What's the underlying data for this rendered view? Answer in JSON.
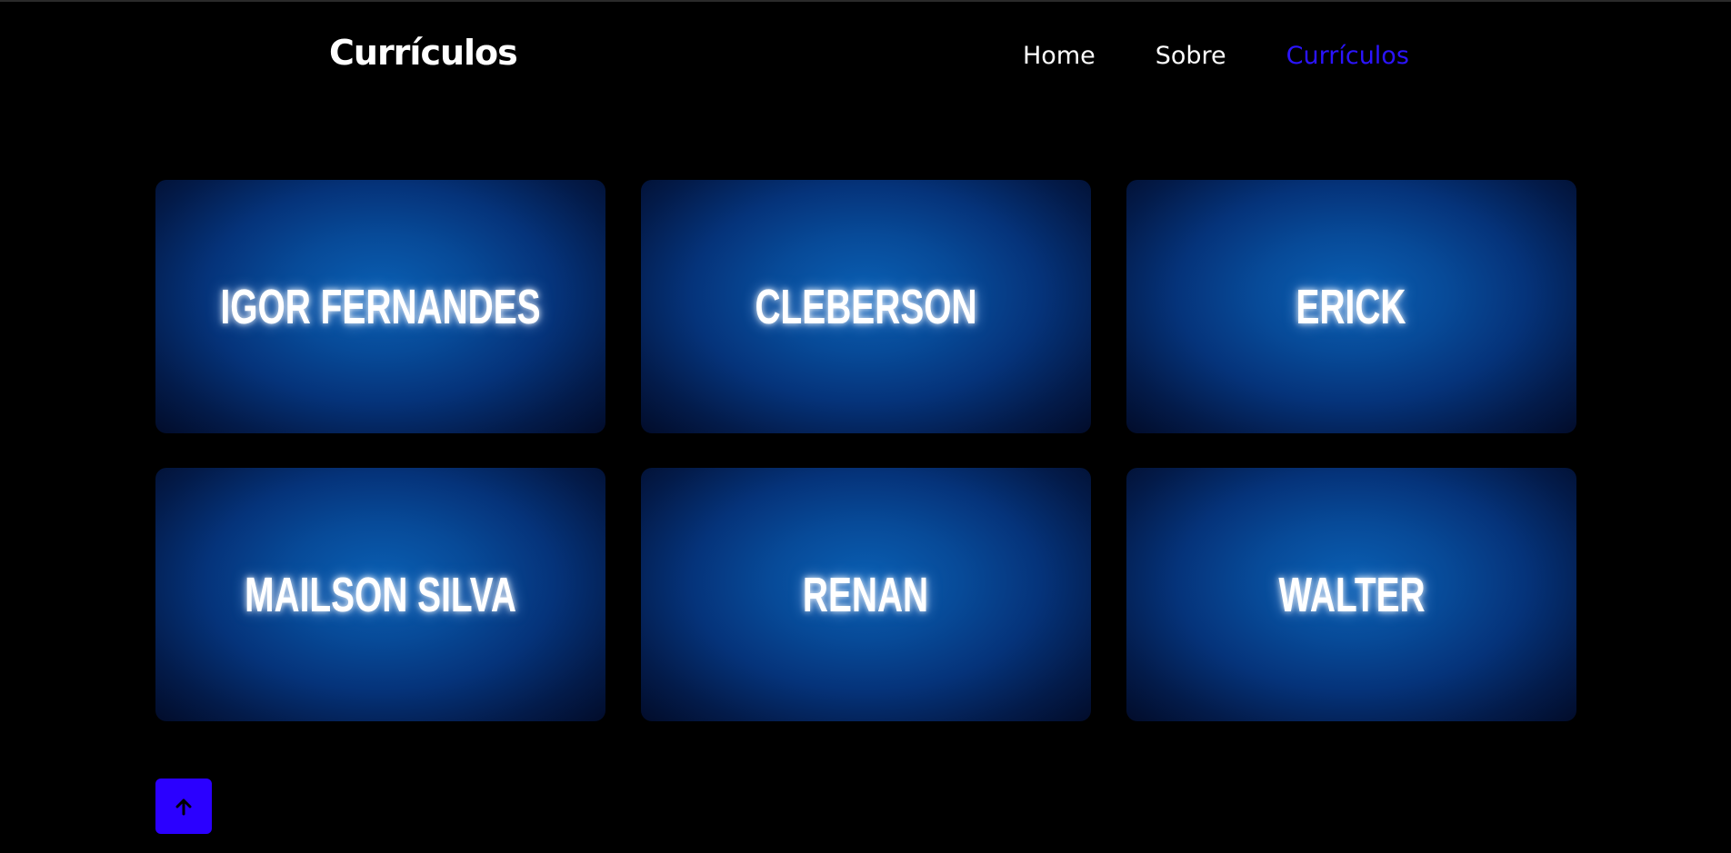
{
  "header": {
    "logo": "Currículos",
    "nav": [
      {
        "label": "Home",
        "active": false
      },
      {
        "label": "Sobre",
        "active": false
      },
      {
        "label": "Currículos",
        "active": true
      }
    ]
  },
  "cards": [
    {
      "name": "IGOR FERNANDES"
    },
    {
      "name": "CLEBERSON"
    },
    {
      "name": "ERICK"
    },
    {
      "name": "MAILSON SILVA"
    },
    {
      "name": "RENAN"
    },
    {
      "name": "WALTER"
    }
  ],
  "back_to_top": {
    "icon": "arrow-up-icon"
  },
  "colors": {
    "background": "#000000",
    "accent": "#2b14ff",
    "button": "#2b00ff",
    "card": "#05337a"
  }
}
